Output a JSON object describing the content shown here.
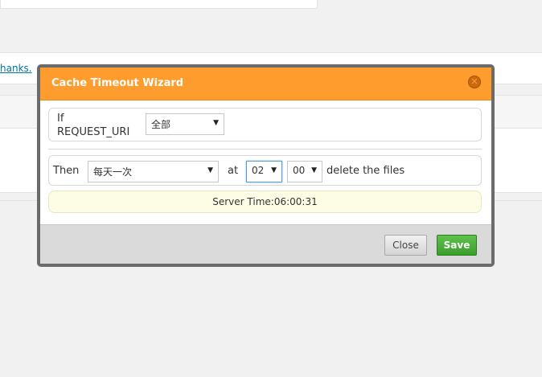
{
  "background": {
    "notice_link": "hanks."
  },
  "dialog": {
    "title": "Cache Timeout Wizard",
    "close_icon": "close-circle-icon",
    "condition": {
      "label_line1": "If",
      "label_line2": "REQUEST_URI",
      "selected": "全部"
    },
    "action": {
      "then_label": "Then",
      "frequency": "每天一次",
      "at_label": "at",
      "hour": "02",
      "minute": "00",
      "suffix": "delete the files"
    },
    "server_time": "Server Time:06:00:31",
    "buttons": {
      "close": "Close",
      "save": "Save"
    }
  },
  "colors": {
    "header": "#fe9c2e",
    "save_button": "#3c9e2c",
    "server_time_bg": "#fdfde6"
  }
}
